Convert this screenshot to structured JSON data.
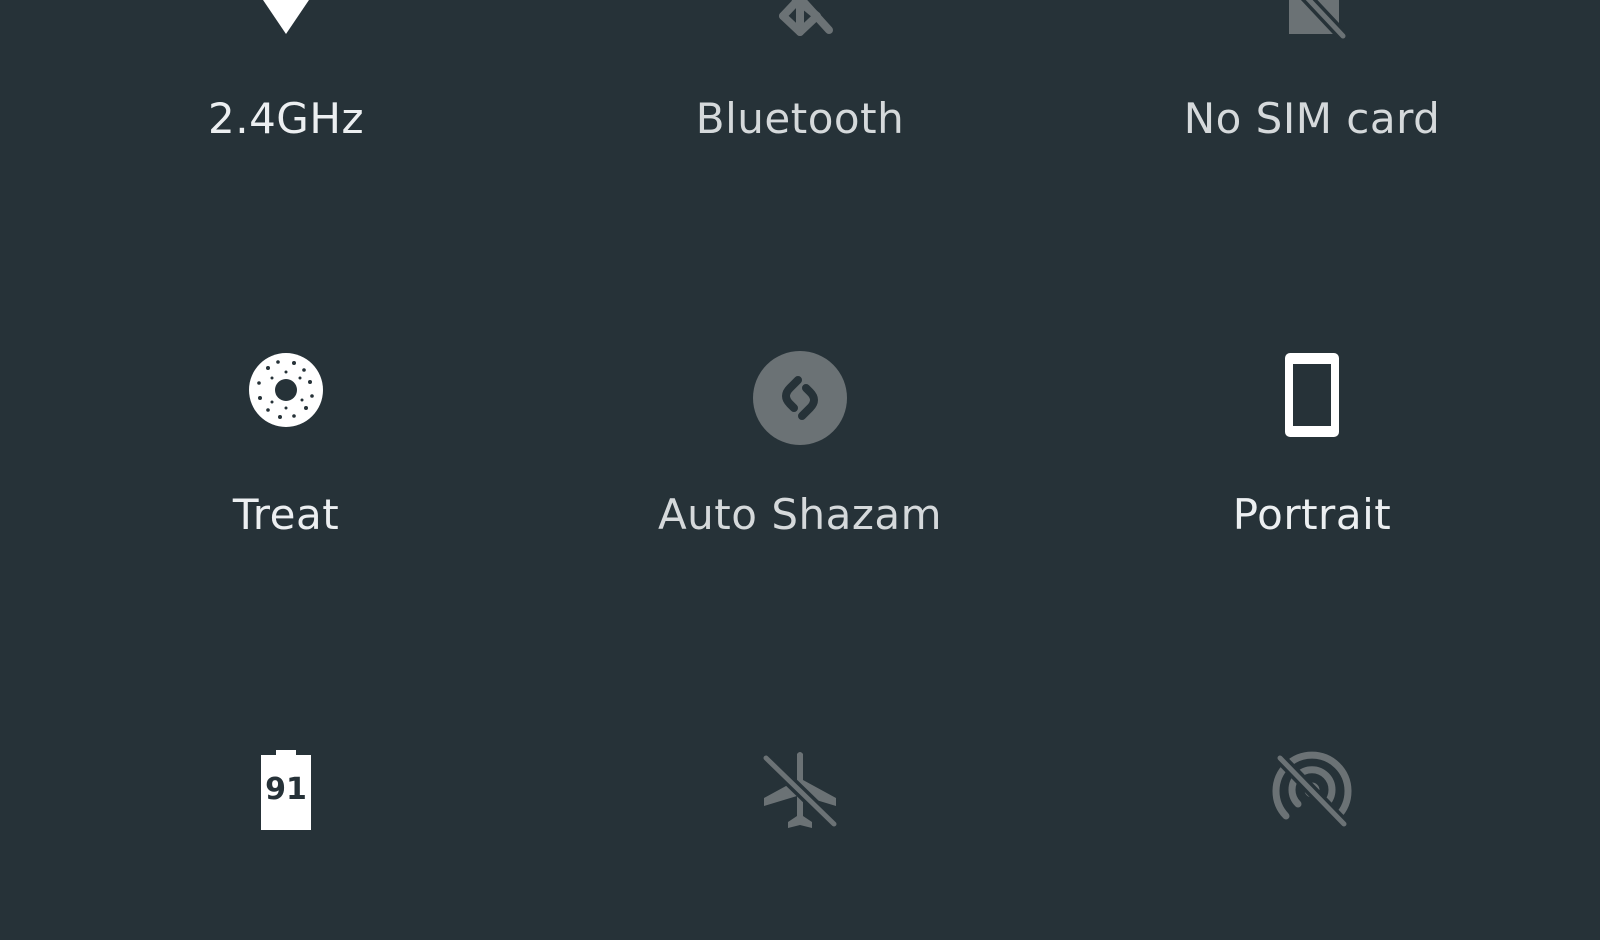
{
  "quick_settings": {
    "tiles": [
      {
        "id": "wifi",
        "label": "2.4GHz",
        "icon": "wifi-icon",
        "active": true
      },
      {
        "id": "bluetooth",
        "label": "Bluetooth",
        "icon": "bluetooth-off-icon",
        "active": false
      },
      {
        "id": "sim",
        "label": "No SIM card",
        "icon": "no-sim-icon",
        "active": false
      },
      {
        "id": "treat",
        "label": "Treat",
        "icon": "donut-icon",
        "active": true
      },
      {
        "id": "shazam",
        "label": "Auto Shazam",
        "icon": "shazam-icon",
        "active": false
      },
      {
        "id": "portrait",
        "label": "Portrait",
        "icon": "portrait-phone-icon",
        "active": true
      },
      {
        "id": "battery",
        "label": "",
        "icon": "battery-icon",
        "value": "91",
        "active": true
      },
      {
        "id": "airplane",
        "label": "",
        "icon": "airplane-mode-off-icon",
        "active": false
      },
      {
        "id": "hotspot",
        "label": "",
        "icon": "hotspot-off-icon",
        "active": false
      }
    ]
  },
  "colors": {
    "background": "#263238",
    "icon_active": "#FFFFFF",
    "icon_inactive": "#6B7275",
    "label_text": "#ECEFF1"
  }
}
